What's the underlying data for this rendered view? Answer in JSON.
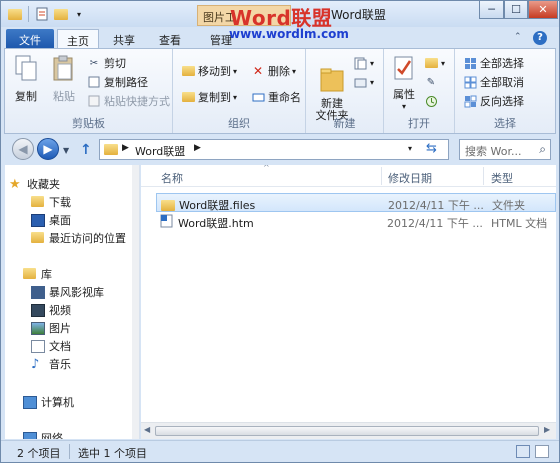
{
  "titlebar": {
    "title": "Word联盟",
    "picture_tools_label": "图片工",
    "watermark_logo": "Word联盟",
    "watermark_url": "www.wordlm.com",
    "controls": {
      "minimize": "─",
      "maximize": "☐",
      "close": "✕"
    }
  },
  "menu": {
    "file_tab": "文件",
    "tabs": [
      {
        "label": "主页",
        "active": true
      },
      {
        "label": "共享",
        "active": false
      },
      {
        "label": "查看",
        "active": false
      },
      {
        "label": "管理",
        "active": false
      }
    ],
    "minimize_ribbon": "⌃",
    "help": "?"
  },
  "ribbon": {
    "clipboard": {
      "label": "剪贴板",
      "copy": "复制",
      "paste": "粘贴",
      "cut": "剪切",
      "copy_path": "复制路径",
      "paste_shortcut": "粘贴快捷方式"
    },
    "organize": {
      "label": "组织",
      "move_to": "移动到",
      "copy_to": "复制到",
      "delete": "删除",
      "rename": "重命名"
    },
    "new": {
      "label": "新建",
      "new_folder": "新建\n文件夹"
    },
    "open": {
      "label": "打开",
      "properties": "属性"
    },
    "select": {
      "label": "选择",
      "select_all": "全部选择",
      "select_none": "全部取消",
      "invert": "反向选择"
    }
  },
  "address": {
    "segments": [
      "Word联盟"
    ],
    "search_placeholder": "搜索 Wor..."
  },
  "nav": {
    "favorites_label": "收藏夹",
    "favorites": [
      "下载",
      "桌面",
      "最近访问的位置"
    ],
    "libraries_label": "库",
    "libraries": [
      "暴风影视库",
      "视频",
      "图片",
      "文档",
      "音乐"
    ],
    "computer": "计算机",
    "network": "网络"
  },
  "files": {
    "columns": [
      "名称",
      "修改日期",
      "类型"
    ],
    "rows": [
      {
        "name": "Word联盟.files",
        "date": "2012/4/11 下午 ...",
        "type": "文件夹"
      },
      {
        "name": "Word联盟.htm",
        "date": "2012/4/11 下午 ...",
        "type": "HTML 文档"
      }
    ]
  },
  "status": {
    "count": "2 个项目",
    "selected": "选中 1 个项目"
  },
  "colors": {
    "accent": "#1f59ad",
    "frame": "#d6e4f5",
    "watermark_red": "#d8332a",
    "watermark_blue": "#1e3fd0"
  }
}
